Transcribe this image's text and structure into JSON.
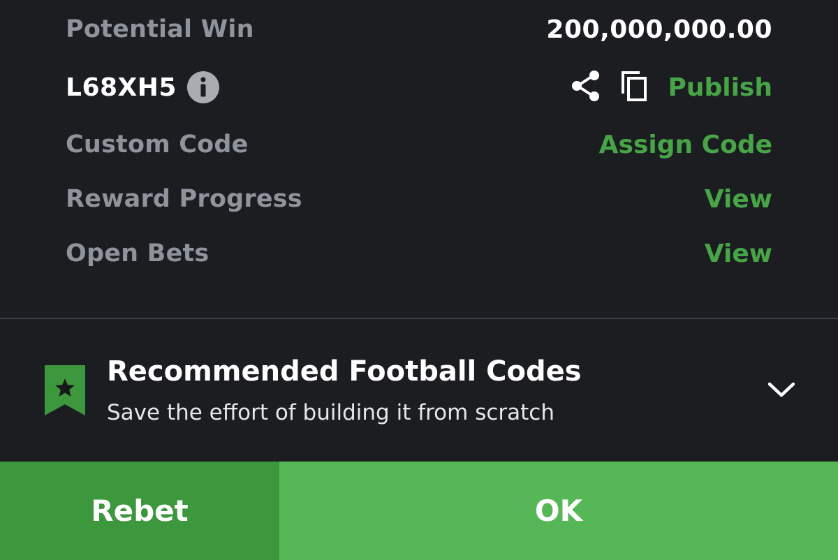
{
  "summary": {
    "potential_win_label": "Potential Win",
    "potential_win_value": "200,000,000.00",
    "booking_code": "L68XH5",
    "publish_label": "Publish",
    "custom_code_label": "Custom Code",
    "assign_code_label": "Assign Code",
    "reward_progress_label": "Reward Progress",
    "reward_progress_action": "View",
    "open_bets_label": "Open Bets",
    "open_bets_action": "View"
  },
  "recommendation": {
    "title": "Recommended Football Codes",
    "subtitle": "Save the effort of building it from scratch"
  },
  "footer": {
    "rebet_label": "Rebet",
    "ok_label": "OK"
  },
  "colors": {
    "background": "#1b1d21",
    "accent_green": "#47a447",
    "rebet_bg": "#3d973d",
    "ok_bg": "#56b756",
    "muted_text": "#8f939c"
  },
  "icons": [
    "info-icon",
    "share-icon",
    "copy-icon",
    "bookmark-star-icon",
    "chevron-down-icon"
  ]
}
